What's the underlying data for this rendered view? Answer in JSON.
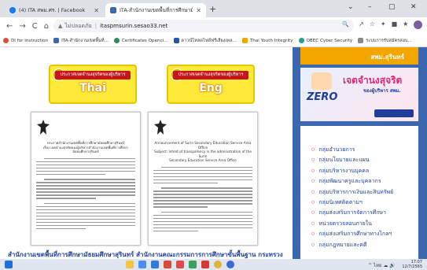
{
  "browser": {
    "tabs": [
      {
        "title": "(4) ITA สพม.ศร. | Facebook",
        "favicon_color": "#1877f2"
      },
      {
        "title": "ITA-สำนักงานเขตพื้นที่การศึกษามัธยม",
        "favicon_color": "#3a67b0"
      }
    ],
    "new_tab": "+",
    "window_controls": [
      "⌄",
      "–",
      "▢",
      "✕"
    ],
    "nav": {
      "back": "←",
      "forward": "→",
      "reload": "C",
      "home": "⌂"
    },
    "address": {
      "security": "ไม่ปลอดภัย",
      "url": "itaspmsurin.sesao33.net"
    },
    "toolbar_icons": [
      "🔍",
      "↗",
      "☆",
      "✦",
      "■",
      "★"
    ],
    "bookmarks": [
      {
        "label": "DI for Instruction",
        "color": "#d94f3d"
      },
      {
        "label": "ITA-สำนักงานเขตพื้นที่...",
        "color": "#3a67b0"
      },
      {
        "label": "Certificates Openci...",
        "color": "#2e8b57"
      },
      {
        "label": "ดาวน์โหลดไฟล์ฟรีเสียงเพล...",
        "color": "#1f56b0"
      },
      {
        "label": "Thai Youth Integrity",
        "color": "#f0a500"
      },
      {
        "label": "OBEC Cyber Security",
        "color": "#2a9d8f"
      },
      {
        "label": "ระบบการรับสมัครสอบ...",
        "color": "#888888"
      }
    ]
  },
  "page": {
    "banners": [
      {
        "ribbon": "ประกาศเจตจำนงสุจริตของผู้บริหาร",
        "label": "Thai"
      },
      {
        "ribbon": "ประกาศเจตจำนงสุจริตของผู้บริหาร",
        "label": "Eng"
      }
    ],
    "documents": [
      {
        "heading": [
          "ประกาศสำนักงานเขตพื้นที่การศึกษามัธยมศึกษาสุรินทร์",
          "เรื่อง เจตจำนงสุจริตของผู้บริหารสำนักงานเขตพื้นที่การศึกษามัธยมศึกษาสุรินทร์"
        ]
      },
      {
        "heading": [
          "Announcement of Surin Secondary Education Service Area Office",
          "Subject: Intent of transparency in the administration of the Surin",
          "Secondary Education Service Area Office"
        ]
      }
    ],
    "footer_title": "สำนักงานเขตพื้นที่การศึกษามัธยมศึกษาสุรินทร์ สำนักงานคณะกรรมการการศึกษาขั้นพื้นฐาน กระทรวง"
  },
  "sidebar": {
    "banner_top": "สพม.สุรินทร์",
    "banner_campaign": {
      "headline": "เจตจำนงสุจริต",
      "sub": "ของผู้บริหาร สพม.",
      "zero": "ZERO"
    },
    "menu": [
      "กลุ่มอำนวยการ",
      "กลุ่มนโยบายและแผน",
      "กลุ่มบริหารงานบุคคล",
      "กลุ่มพัฒนาครูและบุคลากร",
      "กลุ่มบริหารการเงินและสินทรัพย์",
      "กลุ่มนิเทศติดตามฯ",
      "กลุ่มส่งเสริมการจัดการศึกษา",
      "หน่วยตรวจสอบภายใน",
      "กลุ่มส่งเสริมการศึกษาทางไกลฯ",
      "กลุ่มกฎหมายและคดี"
    ]
  },
  "taskbar": {
    "apps": [
      {
        "name": "file-explorer",
        "color": "#f4c542"
      },
      {
        "name": "chrome",
        "color": "#4a8df5"
      },
      {
        "name": "edge",
        "color": "#2f7bd8"
      },
      {
        "name": "app-red-1",
        "color": "#d84a3a"
      },
      {
        "name": "app-red-2",
        "color": "#e04a4a"
      },
      {
        "name": "app-green",
        "color": "#38a15c"
      },
      {
        "name": "app-red-3",
        "color": "#d63a30"
      },
      {
        "name": "app-chrome-2",
        "color": "#e0b43a"
      },
      {
        "name": "app-blue",
        "color": "#3a6ad8"
      }
    ],
    "tray_icons": "^ ไทย ☁ 🔊",
    "time": "17:07",
    "date": "12/7/2565"
  }
}
